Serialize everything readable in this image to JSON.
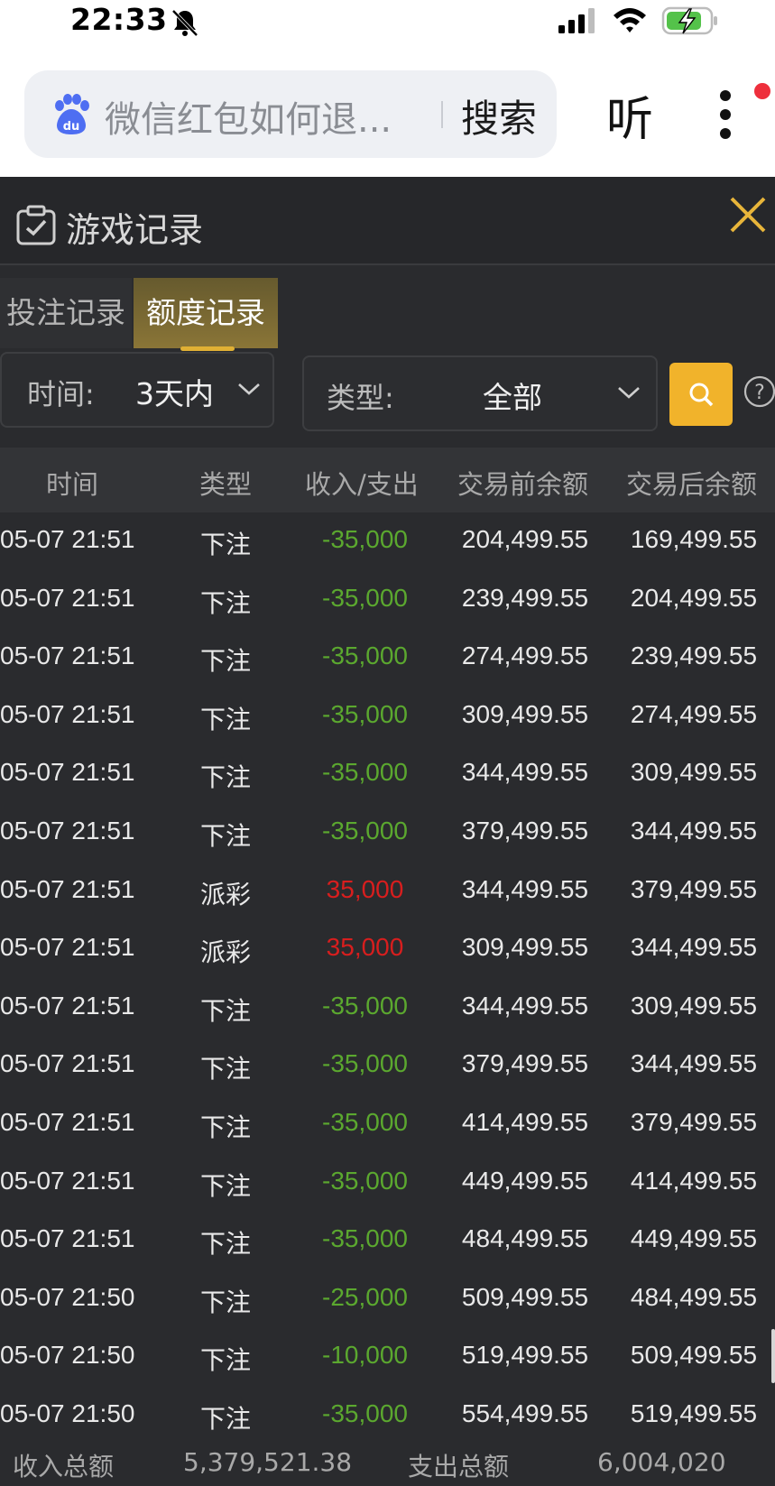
{
  "status_bar": {
    "time": "22:33"
  },
  "search": {
    "query": "微信红包如何退...",
    "submit_label": "搜索",
    "listen_label": "听"
  },
  "panel": {
    "title": "游戏记录",
    "tabs": [
      {
        "label": "投注记录"
      },
      {
        "label": "额度记录"
      }
    ],
    "active_tab": "额度记录",
    "filters": {
      "time": {
        "label": "时间:",
        "value": "3天内"
      },
      "type": {
        "label": "类型:",
        "value": "全部"
      }
    }
  },
  "table": {
    "headers": [
      "时间",
      "类型",
      "收入/支出",
      "交易前余额",
      "交易后余额"
    ],
    "rows": [
      {
        "time": "05-07 21:51",
        "type": "下注",
        "amount": "-35,000",
        "before": "204,499.55",
        "after": "169,499.55",
        "sign": "neg"
      },
      {
        "time": "05-07 21:51",
        "type": "下注",
        "amount": "-35,000",
        "before": "239,499.55",
        "after": "204,499.55",
        "sign": "neg"
      },
      {
        "time": "05-07 21:51",
        "type": "下注",
        "amount": "-35,000",
        "before": "274,499.55",
        "after": "239,499.55",
        "sign": "neg"
      },
      {
        "time": "05-07 21:51",
        "type": "下注",
        "amount": "-35,000",
        "before": "309,499.55",
        "after": "274,499.55",
        "sign": "neg"
      },
      {
        "time": "05-07 21:51",
        "type": "下注",
        "amount": "-35,000",
        "before": "344,499.55",
        "after": "309,499.55",
        "sign": "neg"
      },
      {
        "time": "05-07 21:51",
        "type": "下注",
        "amount": "-35,000",
        "before": "379,499.55",
        "after": "344,499.55",
        "sign": "neg"
      },
      {
        "time": "05-07 21:51",
        "type": "派彩",
        "amount": "35,000",
        "before": "344,499.55",
        "after": "379,499.55",
        "sign": "pos"
      },
      {
        "time": "05-07 21:51",
        "type": "派彩",
        "amount": "35,000",
        "before": "309,499.55",
        "after": "344,499.55",
        "sign": "pos"
      },
      {
        "time": "05-07 21:51",
        "type": "下注",
        "amount": "-35,000",
        "before": "344,499.55",
        "after": "309,499.55",
        "sign": "neg"
      },
      {
        "time": "05-07 21:51",
        "type": "下注",
        "amount": "-35,000",
        "before": "379,499.55",
        "after": "344,499.55",
        "sign": "neg"
      },
      {
        "time": "05-07 21:51",
        "type": "下注",
        "amount": "-35,000",
        "before": "414,499.55",
        "after": "379,499.55",
        "sign": "neg"
      },
      {
        "time": "05-07 21:51",
        "type": "下注",
        "amount": "-35,000",
        "before": "449,499.55",
        "after": "414,499.55",
        "sign": "neg"
      },
      {
        "time": "05-07 21:51",
        "type": "下注",
        "amount": "-35,000",
        "before": "484,499.55",
        "after": "449,499.55",
        "sign": "neg"
      },
      {
        "time": "05-07 21:50",
        "type": "下注",
        "amount": "-25,000",
        "before": "509,499.55",
        "after": "484,499.55",
        "sign": "neg"
      },
      {
        "time": "05-07 21:50",
        "type": "下注",
        "amount": "-10,000",
        "before": "519,499.55",
        "after": "509,499.55",
        "sign": "neg"
      },
      {
        "time": "05-07 21:50",
        "type": "下注",
        "amount": "-35,000",
        "before": "554,499.55",
        "after": "519,499.55",
        "sign": "neg"
      }
    ]
  },
  "summary": {
    "income_label": "收入总额",
    "income_value": "5,379,521.38",
    "expense_label": "支出总额",
    "expense_value": "6,004,020"
  },
  "colors": {
    "accent": "#f1b32b",
    "negative": "#5ba82f",
    "positive": "#d81e1e",
    "panel_bg": "#2a2b2e"
  },
  "icons": [
    "mute-bell-icon",
    "signal-icon",
    "wifi-icon",
    "battery-charging-icon",
    "baidu-paw-icon",
    "more-vertical-icon",
    "clipboard-check-icon",
    "close-icon",
    "chevron-down-icon",
    "search-icon",
    "help-icon"
  ]
}
